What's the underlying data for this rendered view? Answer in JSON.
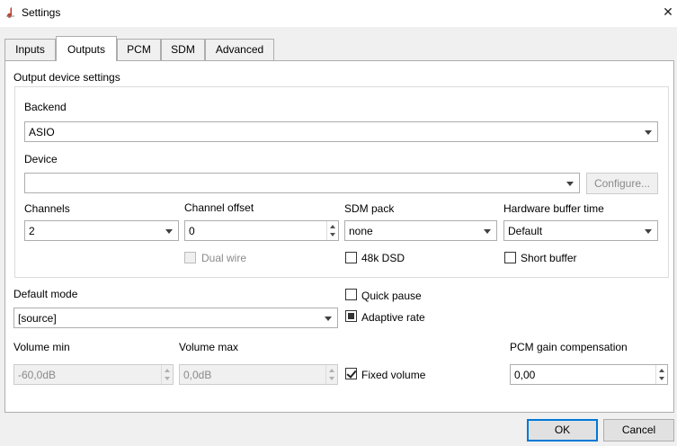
{
  "window": {
    "title": "Settings"
  },
  "tabs": [
    "Inputs",
    "Outputs",
    "PCM",
    "SDM",
    "Advanced"
  ],
  "active_tab": "Outputs",
  "group": {
    "title": "Output device settings"
  },
  "backend": {
    "label": "Backend",
    "value": "ASIO"
  },
  "device": {
    "label": "Device",
    "value": "",
    "configure_label": "Configure..."
  },
  "channels": {
    "label": "Channels",
    "value": "2"
  },
  "channel_offset": {
    "label": "Channel offset",
    "value": "0"
  },
  "sdm_pack": {
    "label": "SDM pack",
    "value": "none"
  },
  "hw_buffer": {
    "label": "Hardware buffer time",
    "value": "Default"
  },
  "dual_wire": {
    "label": "Dual wire",
    "checked": false,
    "enabled": false
  },
  "dsd_48k": {
    "label": "48k DSD",
    "checked": false
  },
  "short_buffer": {
    "label": "Short buffer",
    "checked": false
  },
  "default_mode": {
    "label": "Default mode",
    "value": "[source]"
  },
  "quick_pause": {
    "label": "Quick pause",
    "checked": false
  },
  "adaptive_rate": {
    "label": "Adaptive rate",
    "state": "partial"
  },
  "volume_min": {
    "label": "Volume min",
    "value": "-60,0dB"
  },
  "volume_max": {
    "label": "Volume max",
    "value": "0,0dB"
  },
  "fixed_volume": {
    "label": "Fixed volume",
    "checked": true
  },
  "pcm_gain": {
    "label": "PCM gain compensation",
    "value": "0,00"
  },
  "buttons": {
    "ok": "OK",
    "cancel": "Cancel"
  },
  "colors": {
    "focus_border": "#0078d7",
    "panel_bg": "#ffffff",
    "window_bg": "#f0f0f0"
  }
}
